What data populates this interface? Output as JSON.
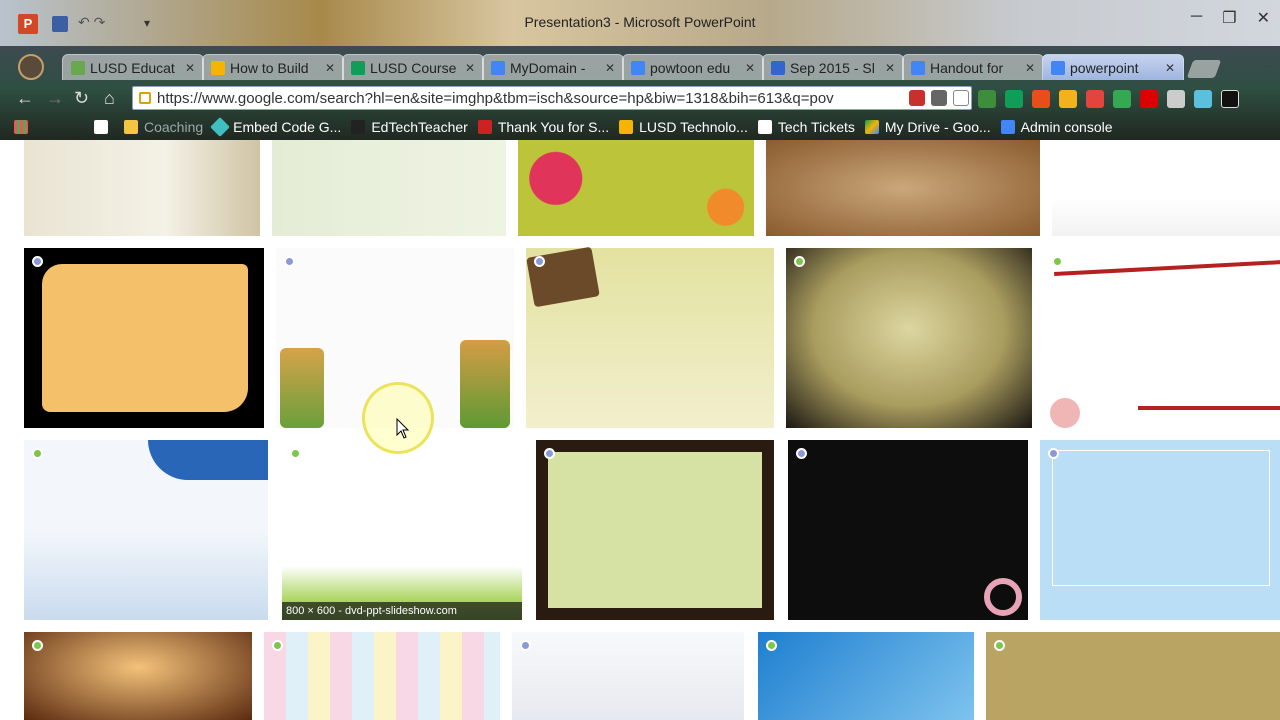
{
  "window": {
    "title": "Presentation3 - Microsoft PowerPoint",
    "app_icon_letter": "P",
    "controls": [
      "─",
      "❐",
      "✕"
    ]
  },
  "browser": {
    "tabs": [
      {
        "label": "LUSD Educat",
        "favicon_color": "#6aa84f",
        "active": false
      },
      {
        "label": "How to Build",
        "favicon_color": "#f4b400",
        "active": false
      },
      {
        "label": "LUSD Course",
        "favicon_color": "#0f9d58",
        "active": false
      },
      {
        "label": "MyDomain -",
        "favicon_color": "#4285f4",
        "active": false
      },
      {
        "label": "powtoon edu",
        "favicon_color": "#4285f4",
        "active": false
      },
      {
        "label": "Sep 2015 - Sl",
        "favicon_color": "#3366cc",
        "active": false
      },
      {
        "label": "Handout for",
        "favicon_color": "#4285f4",
        "active": false
      },
      {
        "label": "powerpoint",
        "favicon_color": "#4285f4",
        "active": true
      }
    ],
    "close_glyph": "✕",
    "url": "https://www.google.com/search?hl=en&site=imghp&tbm=isch&source=hp&biw=1318&bih=613&q=pov",
    "bookmarks": [
      {
        "label": "",
        "favicon_color": "#ffffff"
      },
      {
        "label": "",
        "favicon_color": "#f4c542"
      },
      {
        "label": "Coaching",
        "favicon_color": "#555555",
        "dim": true
      },
      {
        "label": "Embed Code G...",
        "favicon_color": "#3fbfbf"
      },
      {
        "label": "EdTechTeacher",
        "favicon_color": "#222222"
      },
      {
        "label": "Thank You for S...",
        "favicon_color": "#cc2222"
      },
      {
        "label": "LUSD Technolo...",
        "favicon_color": "#f4b400"
      },
      {
        "label": "Tech Tickets",
        "favicon_color": "#ffffff"
      },
      {
        "label": "My Drive - Goo...",
        "favicon_color": "#0f9d58"
      },
      {
        "label": "Admin console",
        "favicon_color": "#4285f4"
      }
    ]
  },
  "results": {
    "hover_caption": "800 × 600 - dvd-ppt-slideshow.com"
  }
}
